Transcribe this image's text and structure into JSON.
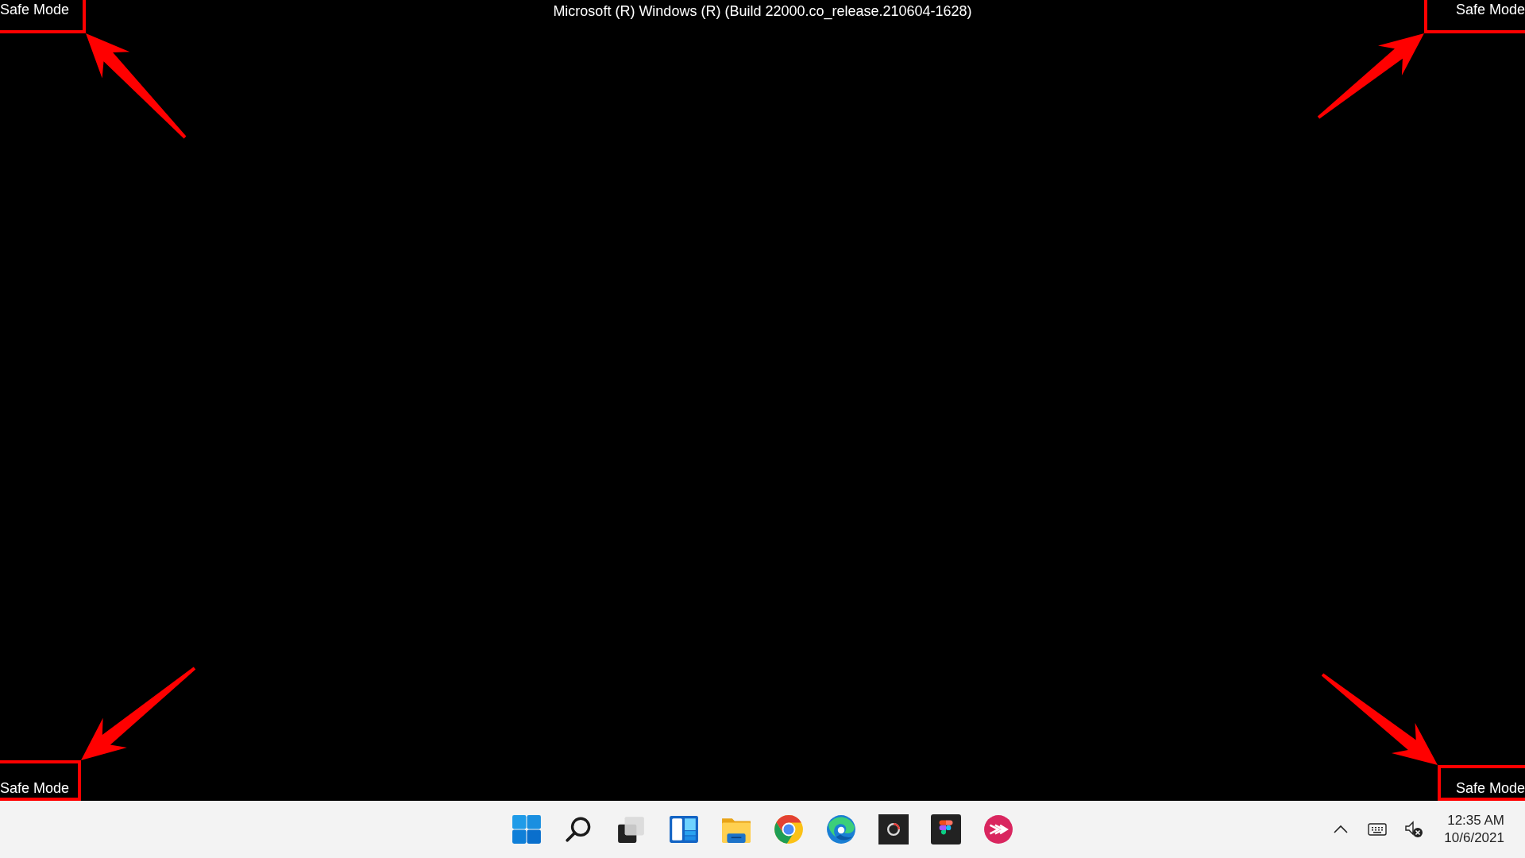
{
  "screen_title": "Microsoft (R) Windows (R) (Build 22000.co_release.210604-1628)",
  "corner_labels": [
    "Safe Mode",
    "Safe Mode",
    "Safe Mode",
    "Safe Mode"
  ],
  "taskbar": {
    "apps": [
      {
        "kind": "start"
      },
      {
        "kind": "search"
      },
      {
        "kind": "taskview"
      },
      {
        "kind": "widgets"
      },
      {
        "kind": "files"
      },
      {
        "kind": "chrome"
      },
      {
        "kind": "edge"
      },
      {
        "kind": "recorder"
      },
      {
        "kind": "figma"
      },
      {
        "kind": "pinkapp"
      }
    ],
    "tray": [
      {
        "kind": "overflow"
      },
      {
        "kind": "keyboard"
      },
      {
        "kind": "volume",
        "muted": true
      }
    ],
    "clock": {
      "time": "12:35 AM",
      "date": "10/6/2021"
    }
  }
}
